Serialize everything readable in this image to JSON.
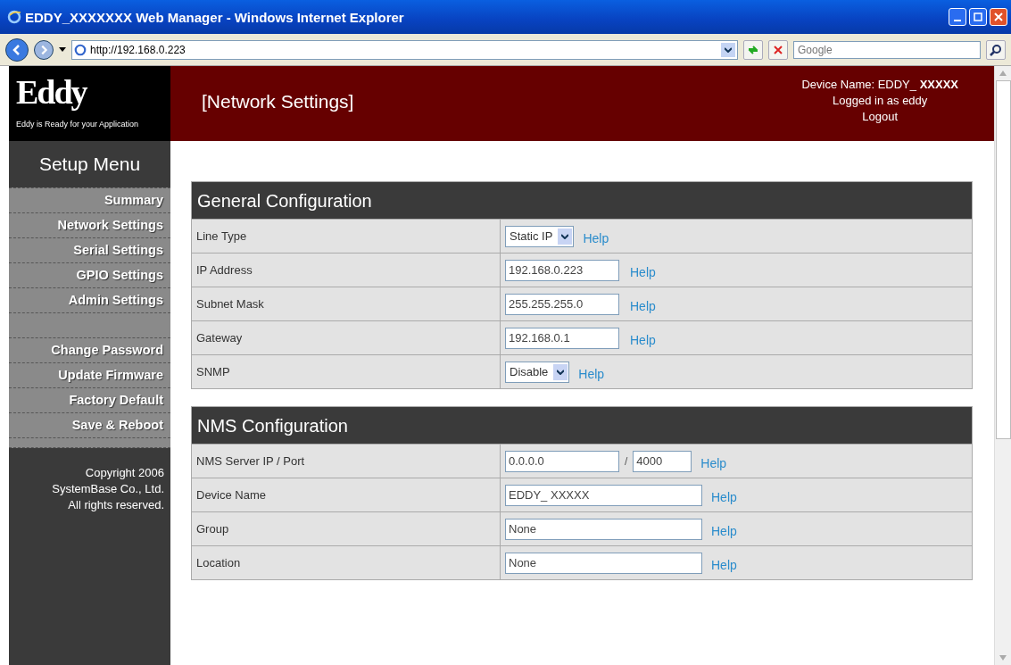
{
  "window": {
    "title": "EDDY_XXXXXXX Web Manager - Windows Internet Explorer"
  },
  "address_bar": {
    "url": "http://192.168.0.223",
    "search_placeholder": "Google"
  },
  "sidebar": {
    "logo": "Eddy",
    "tagline": "Eddy is Ready for your Application",
    "menu_title": "Setup Menu",
    "menu_groups": [
      [
        "Summary",
        "Network Settings",
        "Serial Settings",
        "GPIO Settings",
        "Admin Settings"
      ],
      [
        "Change Password",
        "Update Firmware",
        "Factory Default",
        "Save & Reboot"
      ]
    ],
    "copyright": [
      "Copyright 2006",
      "SystemBase Co., Ltd.",
      "All rights reserved."
    ]
  },
  "header": {
    "page_title": "[Network Settings]",
    "device_name": "Device Name: EDDY_ **XXXXX**",
    "login": "Logged in as eddy",
    "logout": "Logout"
  },
  "sections": [
    {
      "title": "General Configuration",
      "rows": [
        {
          "kind": "select",
          "label": "Line Type",
          "value": "Static IP",
          "help": "Help"
        },
        {
          "kind": "input",
          "label": "IP Address",
          "value": "192.168.0.223",
          "help": "Help"
        },
        {
          "kind": "input",
          "label": "Subnet Mask",
          "value": "255.255.255.0",
          "help": "Help"
        },
        {
          "kind": "input",
          "label": "Gateway",
          "value": "192.168.0.1",
          "help": "Help"
        },
        {
          "kind": "select",
          "label": "SNMP",
          "value": "Disable",
          "help": "Help"
        }
      ]
    },
    {
      "title": "NMS Configuration",
      "rows": [
        {
          "kind": "pair",
          "label": "NMS Server IP / Port",
          "value": "0.0.0.0",
          "separator": "/",
          "value2": "4000",
          "help": "Help"
        },
        {
          "kind": "wide",
          "label": "Device Name",
          "value": "EDDY_ XXXXX",
          "help": "Help"
        },
        {
          "kind": "wide",
          "label": "Group",
          "value": "None",
          "help": "Help"
        },
        {
          "kind": "wide",
          "label": "Location",
          "value": "None",
          "help": "Help"
        }
      ]
    }
  ]
}
